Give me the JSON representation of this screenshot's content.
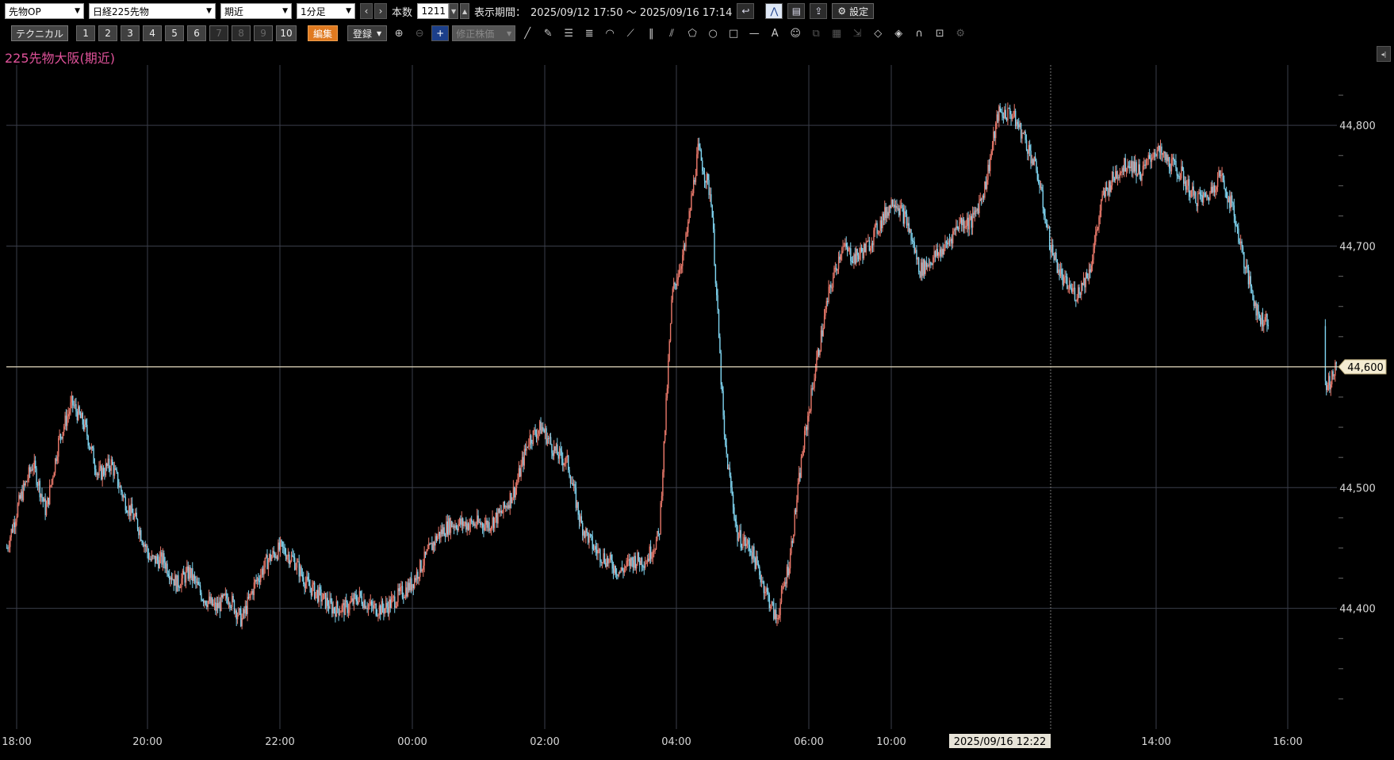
{
  "toolbar": {
    "instrument_type": "先物OP",
    "instrument": "日経225先物",
    "contract": "期近",
    "interval": "1分足",
    "bars_label": "本数",
    "bars_value": "1211",
    "period_label": "表示期間：",
    "period_value": "2025/09/12 17:50 ～ 2025/09/16 17:14",
    "settings_label": "設定"
  },
  "toolbar2": {
    "technical_label": "テクニカル",
    "numbers": [
      "1",
      "2",
      "3",
      "4",
      "5",
      "6",
      "7",
      "8",
      "9",
      "10"
    ],
    "edit_label": "編集",
    "register_label": "登録",
    "adjusted_price_label": "修正株価"
  },
  "chart_title": "225先物大阪(期近)",
  "colors": {
    "up": "#e8786a",
    "down": "#7fd4f0",
    "title": "#e0529a",
    "grid": "#3a3e4a"
  },
  "chart_data": {
    "type": "candlestick",
    "x_ticks": [
      "18:00",
      "20:00",
      "22:00",
      "00:00",
      "02:00",
      "04:00",
      "06:00",
      "10:00",
      "14:00",
      "16:00"
    ],
    "y_ticks": [
      44800,
      44700,
      44600,
      44500,
      44400
    ],
    "y_tick_labels": [
      "44,800",
      "44,700",
      "44,600",
      "44,500",
      "44,400"
    ],
    "ylim": [
      44300,
      44850
    ],
    "current_price": "44,600",
    "cursor_time": "2025/09/16 12:22",
    "approx_path": [
      [
        0,
        44450
      ],
      [
        10,
        44490
      ],
      [
        20,
        44520
      ],
      [
        30,
        44480
      ],
      [
        40,
        44540
      ],
      [
        50,
        44570
      ],
      [
        60,
        44550
      ],
      [
        70,
        44510
      ],
      [
        80,
        44520
      ],
      [
        90,
        44490
      ],
      [
        100,
        44470
      ],
      [
        110,
        44440
      ],
      [
        120,
        44440
      ],
      [
        130,
        44420
      ],
      [
        140,
        44430
      ],
      [
        150,
        44410
      ],
      [
        160,
        44400
      ],
      [
        170,
        44410
      ],
      [
        180,
        44390
      ],
      [
        190,
        44420
      ],
      [
        200,
        44440
      ],
      [
        210,
        44450
      ],
      [
        220,
        44440
      ],
      [
        230,
        44420
      ],
      [
        240,
        44410
      ],
      [
        250,
        44400
      ],
      [
        260,
        44400
      ],
      [
        270,
        44410
      ],
      [
        280,
        44400
      ],
      [
        290,
        44400
      ],
      [
        300,
        44410
      ],
      [
        310,
        44420
      ],
      [
        320,
        44440
      ],
      [
        330,
        44460
      ],
      [
        340,
        44470
      ],
      [
        350,
        44470
      ],
      [
        360,
        44470
      ],
      [
        370,
        44470
      ],
      [
        380,
        44480
      ],
      [
        390,
        44500
      ],
      [
        400,
        44540
      ],
      [
        410,
        44550
      ],
      [
        420,
        44530
      ],
      [
        430,
        44520
      ],
      [
        440,
        44470
      ],
      [
        450,
        44450
      ],
      [
        460,
        44440
      ],
      [
        470,
        44430
      ],
      [
        480,
        44440
      ],
      [
        490,
        44440
      ],
      [
        500,
        44460
      ],
      [
        510,
        44660
      ],
      [
        520,
        44700
      ],
      [
        530,
        44780
      ],
      [
        540,
        44740
      ],
      [
        550,
        44540
      ],
      [
        560,
        44460
      ],
      [
        570,
        44450
      ],
      [
        580,
        44420
      ],
      [
        590,
        44390
      ],
      [
        600,
        44440
      ],
      [
        610,
        44530
      ],
      [
        620,
        44600
      ],
      [
        630,
        44660
      ],
      [
        640,
        44700
      ],
      [
        650,
        44690
      ],
      [
        660,
        44700
      ],
      [
        670,
        44720
      ],
      [
        680,
        44740
      ],
      [
        690,
        44720
      ],
      [
        700,
        44680
      ],
      [
        710,
        44690
      ],
      [
        720,
        44700
      ],
      [
        730,
        44720
      ],
      [
        740,
        44720
      ],
      [
        750,
        44750
      ],
      [
        760,
        44810
      ],
      [
        770,
        44810
      ],
      [
        780,
        44790
      ],
      [
        790,
        44760
      ],
      [
        800,
        44700
      ],
      [
        810,
        44670
      ],
      [
        820,
        44660
      ],
      [
        830,
        44680
      ],
      [
        840,
        44740
      ],
      [
        850,
        44760
      ],
      [
        860,
        44770
      ],
      [
        870,
        44760
      ],
      [
        880,
        44780
      ],
      [
        890,
        44770
      ],
      [
        900,
        44760
      ],
      [
        910,
        44740
      ],
      [
        920,
        44740
      ],
      [
        930,
        44760
      ],
      [
        940,
        44730
      ],
      [
        950,
        44680
      ],
      [
        960,
        44640
      ],
      [
        970,
        44640
      ],
      [
        980,
        44610
      ],
      [
        990,
        44590
      ],
      [
        1000,
        44560
      ],
      [
        1010,
        44580
      ],
      [
        1020,
        44600
      ]
    ]
  }
}
